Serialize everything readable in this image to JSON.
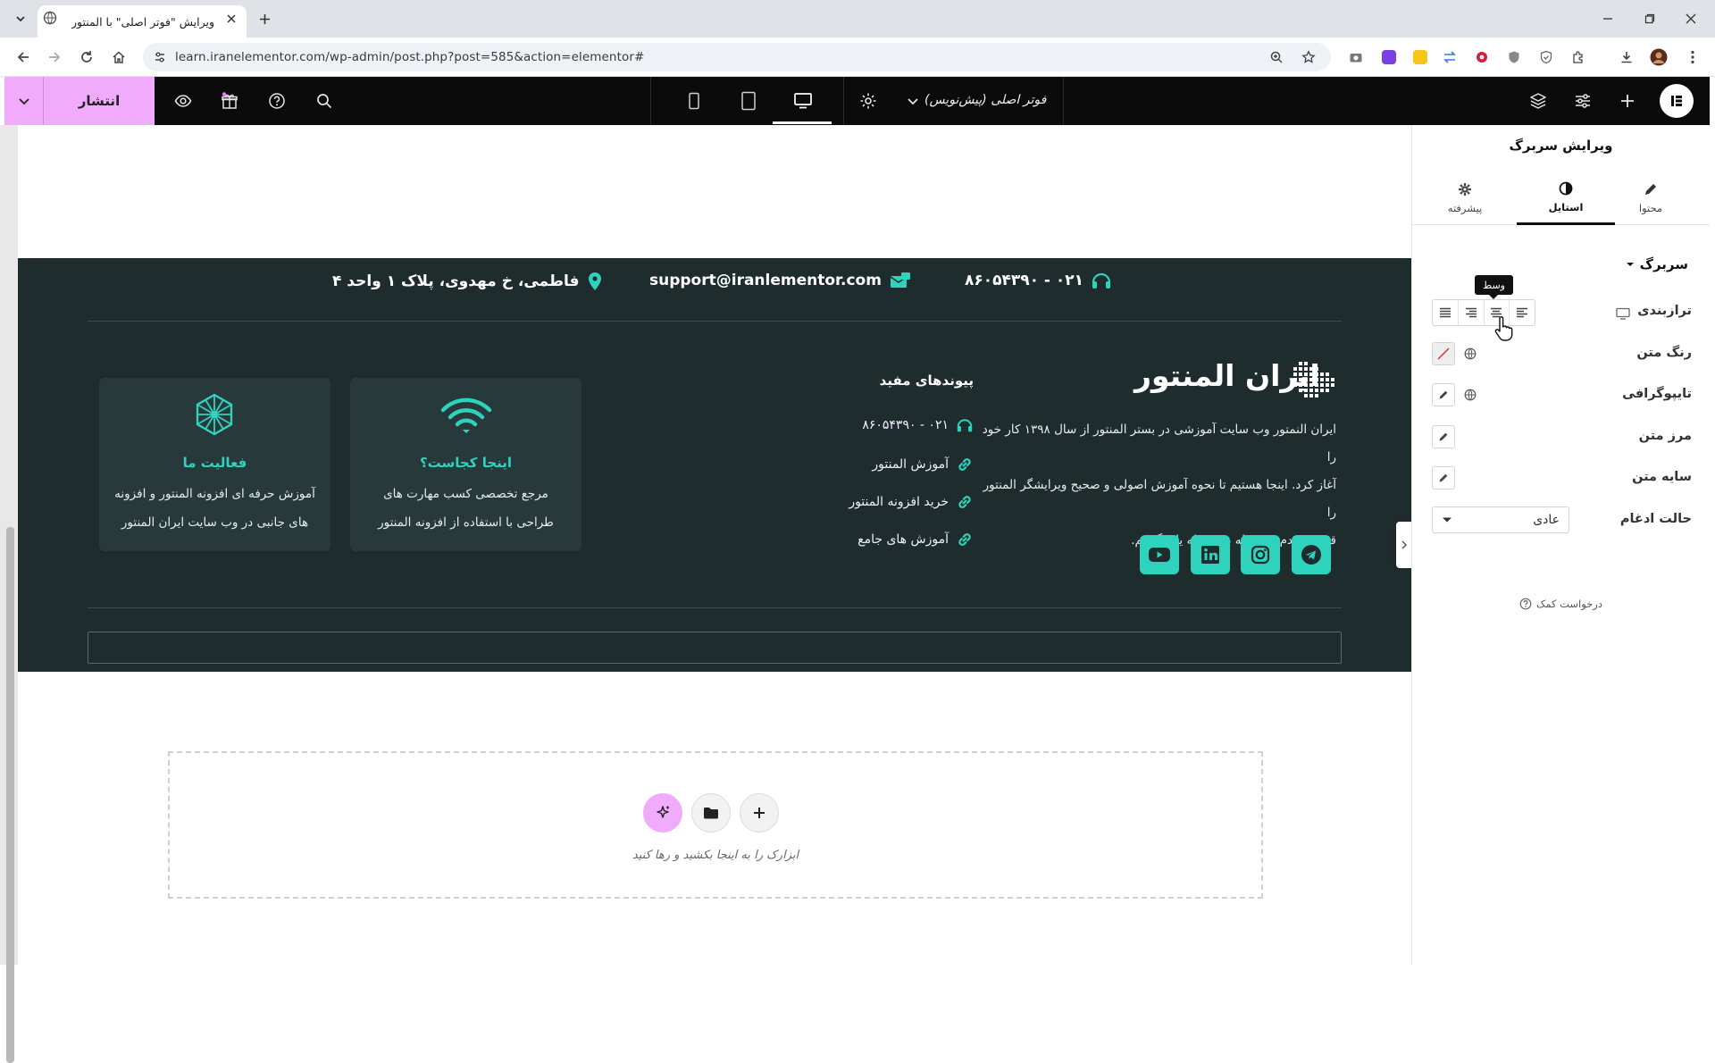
{
  "browser": {
    "tab_title": "ویرایش \"فوتر اصلی\" با المنتور",
    "url": "learn.iranelementor.com/wp-admin/post.php?post=585&action=elementor#"
  },
  "editor": {
    "publish_label": "انتشار",
    "document_title": "فوتر اصلی (پیش‌نویس)"
  },
  "footer": {
    "phone": "۰۲۱ - ۸۶۰۵۴۳۹۰",
    "email": "support@iranlementor.com",
    "address": "فاطمی، خ مهدوی، پلاک ۱ واحد ۴",
    "brand": "ایران المنتور",
    "about_lines": [
      "ایران النمتور وب سایت آموزشی در بستر المنتور از سال ۱۳۹۸ کار خود را",
      "آغاز کرد. اینجا هستیم تا نحوه آموزش اصولی و صحیح ویرایشگر المنتور را",
      "قدم به قدم و مرحله به مرحله یاد بگیریم."
    ],
    "links_title": "پیوندهای مفید",
    "links": [
      "۰۲۱ - ۸۶۰۵۴۳۹۰",
      "آموزش المنتور",
      "خرید افزونه المنتور",
      "آموزش های جامع"
    ],
    "cards": [
      {
        "title": "اینجا کجاست؟",
        "line1": "مرجع تخصصی کسب مهارت های",
        "line2": "طراحی با استفاده از افزونه المنتور"
      },
      {
        "title": "فعالیت ما",
        "line1": "آموزش حرفه ای افزونه المنتور و افزونه",
        "line2": "های جانبی در وب سایت ایران المنتور"
      }
    ],
    "colors": {
      "background": "#1f2c2e",
      "accent": "#2fd3bd",
      "card": "#27393b"
    }
  },
  "dropzone": {
    "label": "ابزارک را به اینجا بکشید و رها کنید"
  },
  "panel": {
    "title": "ویرایش سربرگ",
    "tabs": [
      "محتوا",
      "استایل",
      "پیشرفته"
    ],
    "active_tab": "استایل",
    "section": "سربرگ",
    "rows": {
      "alignment": "ترازبندی",
      "text_color": "رنگ متن",
      "typography": "تایپوگرافی",
      "text_stroke": "مرز متن",
      "text_shadow": "سایه متن",
      "blend_mode": "حالت ادغام"
    },
    "blend_value": "عادی",
    "tooltip": "وسط",
    "help": "درخواست کمک"
  }
}
